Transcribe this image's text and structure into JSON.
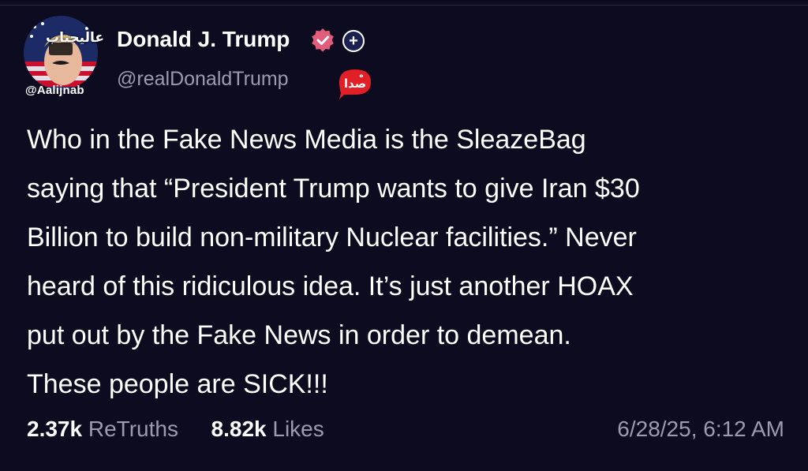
{
  "watermark": {
    "logo_text": "عالیجناب",
    "handle": "@Aalijnab"
  },
  "header": {
    "name": "Donald J. Trump",
    "handle": "@realDonaldTrump",
    "verified_icon": "verified-badge-icon",
    "plus_icon": "plus-circle-icon",
    "logo_icon": "sada-news-logo"
  },
  "post": {
    "lines": [
      "Who in the Fake News Media is the SleazeBag",
      "saying that “President Trump wants to give Iran $30",
      "Billion to build non-military Nuclear facilities.” Never",
      "heard of this ridiculous idea. It’s just another HOAX",
      "put out by the Fake News in order to demean.",
      "These people are SICK!!!"
    ]
  },
  "stats": {
    "retruths_count": "2.37k",
    "retruths_label": "ReTruths",
    "likes_count": "8.82k",
    "likes_label": "Likes",
    "timestamp": "6/28/25, 6:12 AM"
  },
  "colors": {
    "background": "#0c0b1f",
    "verified": "#e25d7c",
    "muted": "#9c9bb0",
    "sada_red": "#e11f26"
  }
}
